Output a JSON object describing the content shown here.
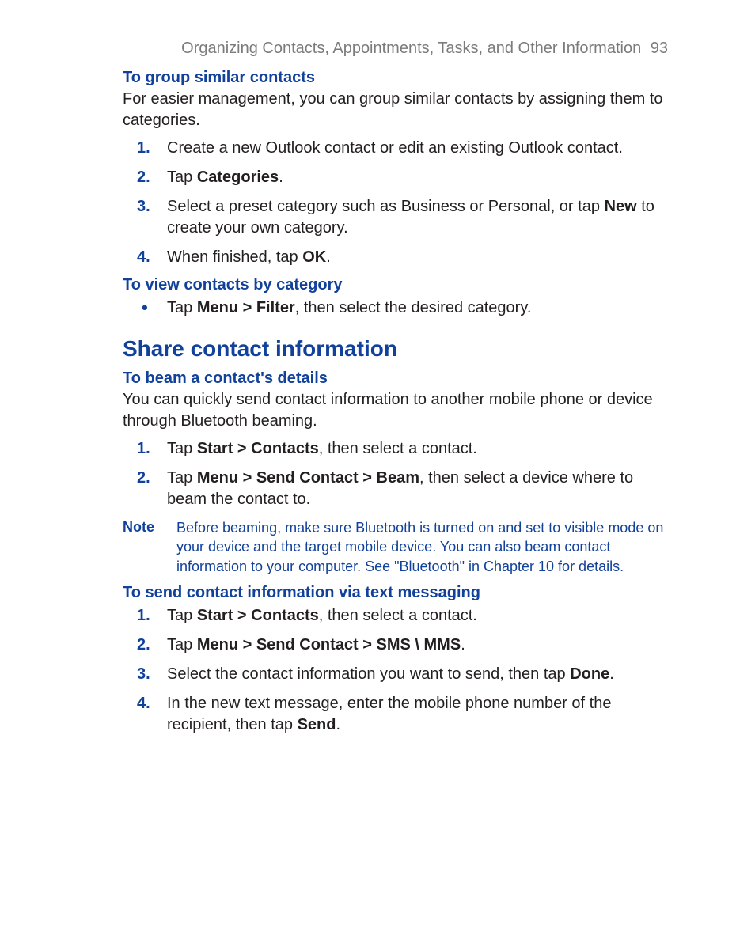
{
  "header": {
    "chapter_title": "Organizing Contacts, Appointments, Tasks, and Other Information",
    "page_number": "93"
  },
  "sections": {
    "group_similar": {
      "heading": "To group similar contacts",
      "intro": "For easier management, you can group similar contacts by assigning them to categories.",
      "steps": {
        "n1": "1.",
        "s1": "Create a new Outlook contact or edit an existing Outlook contact.",
        "n2": "2.",
        "s2_pre": "Tap ",
        "s2_b": "Categories",
        "s2_post": ".",
        "n3": "3.",
        "s3_pre": "Select a preset category such as Business or Personal, or tap ",
        "s3_b": "New",
        "s3_post": " to create your own category.",
        "n4": "4.",
        "s4_pre": "When finished, tap ",
        "s4_b": "OK",
        "s4_post": "."
      }
    },
    "view_by_category": {
      "heading": "To view contacts by category",
      "bullet_pre": "Tap ",
      "bullet_b": "Menu > Filter",
      "bullet_post": ", then select the desired category."
    },
    "share": {
      "heading": "Share contact information"
    },
    "beam": {
      "heading": "To beam a contact's details",
      "intro": "You can quickly send contact information to another mobile phone or device through Bluetooth beaming.",
      "steps": {
        "n1": "1.",
        "s1_pre": "Tap ",
        "s1_b": "Start > Contacts",
        "s1_post": ", then select a contact.",
        "n2": "2.",
        "s2_pre": "Tap ",
        "s2_b": "Menu > Send Contact > Beam",
        "s2_post": ", then select a device where to beam the contact to."
      }
    },
    "note": {
      "label": "Note",
      "body": "Before beaming, make sure Bluetooth is turned on and set to visible mode on your device and the target mobile device. You can also beam contact information to your computer. See \"Bluetooth\" in Chapter 10 for details."
    },
    "sms": {
      "heading": "To send contact information via text messaging",
      "steps": {
        "n1": "1.",
        "s1_pre": "Tap ",
        "s1_b": "Start > Contacts",
        "s1_post": ", then select a contact.",
        "n2": "2.",
        "s2_pre": "Tap ",
        "s2_b": "Menu > Send Contact > SMS \\ MMS",
        "s2_post": ".",
        "n3": "3.",
        "s3_pre": "Select the contact information you want to send, then tap ",
        "s3_b": "Done",
        "s3_post": ".",
        "n4": "4.",
        "s4_pre": "In the new text message, enter the mobile phone number of the recipient, then tap ",
        "s4_b": "Send",
        "s4_post": "."
      }
    }
  }
}
